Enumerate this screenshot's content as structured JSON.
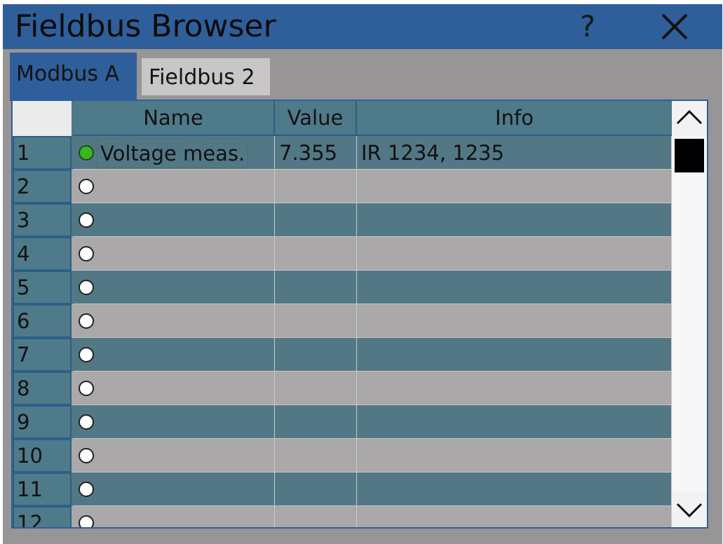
{
  "window": {
    "title": "Fieldbus Browser",
    "help_label": "?"
  },
  "tabs": [
    {
      "label": "Modbus A",
      "active": true
    },
    {
      "label": "Fieldbus 2",
      "active": false
    }
  ],
  "table": {
    "columns": [
      "Name",
      "Value",
      "Info"
    ],
    "rows": [
      {
        "num": "1",
        "status": "active",
        "name": "Voltage meas.",
        "value": "7.355",
        "info": "IR 1234, 1235"
      },
      {
        "num": "2",
        "status": "inactive",
        "name": "",
        "value": "",
        "info": ""
      },
      {
        "num": "3",
        "status": "inactive",
        "name": "",
        "value": "",
        "info": ""
      },
      {
        "num": "4",
        "status": "inactive",
        "name": "",
        "value": "",
        "info": ""
      },
      {
        "num": "5",
        "status": "inactive",
        "name": "",
        "value": "",
        "info": ""
      },
      {
        "num": "6",
        "status": "inactive",
        "name": "",
        "value": "",
        "info": ""
      },
      {
        "num": "7",
        "status": "inactive",
        "name": "",
        "value": "",
        "info": ""
      },
      {
        "num": "8",
        "status": "inactive",
        "name": "",
        "value": "",
        "info": ""
      },
      {
        "num": "9",
        "status": "inactive",
        "name": "",
        "value": "",
        "info": ""
      },
      {
        "num": "10",
        "status": "inactive",
        "name": "",
        "value": "",
        "info": ""
      },
      {
        "num": "11",
        "status": "inactive",
        "name": "",
        "value": "",
        "info": ""
      },
      {
        "num": "12",
        "status": "inactive",
        "name": "",
        "value": "",
        "info": ""
      }
    ]
  },
  "colors": {
    "accent": "#2f5f9b",
    "row_dark": "#527886",
    "row_light": "#aaa8a8",
    "status_active": "#3cb521"
  },
  "icons": {
    "help": "help-icon",
    "close": "close-icon",
    "scroll_up": "chevron-up-icon",
    "scroll_down": "chevron-down-icon"
  }
}
